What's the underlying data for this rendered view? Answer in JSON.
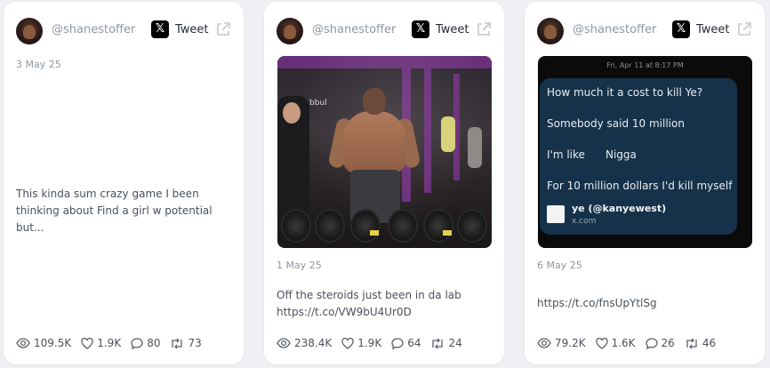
{
  "cards": [
    {
      "handle": "@shanestoffer",
      "tweet_label": "Tweet",
      "date": "3 May 25",
      "text_lines": [
        "This kinda sum crazy game I been",
        "thinking about Find a girl w potential but..."
      ],
      "stats": {
        "views": "109.5K",
        "likes": "1.9K",
        "replies": "80",
        "retweets": "73"
      }
    },
    {
      "handle": "@shanestoffer",
      "tweet_label": "Tweet",
      "date": "1 May 25",
      "text_lines": [
        "Off the steroids just been in da lab",
        "https://t.co/VW9bU4Ur0D"
      ],
      "stats": {
        "views": "238.4K",
        "likes": "1.9K",
        "replies": "64",
        "retweets": "24"
      },
      "photo_watermark": "bbul"
    },
    {
      "handle": "@shanestoffer",
      "tweet_label": "Tweet",
      "date": "6 May 25",
      "text_lines": [
        "https://t.co/fnsUpYtlSg"
      ],
      "stats": {
        "views": "79.2K",
        "likes": "1.6K",
        "replies": "26",
        "retweets": "46"
      },
      "message": {
        "time": "Fri, Apr 11 at 8:17 PM",
        "lines": [
          "How much it a cost to kill Ye?",
          "Somebody said 10 million",
          "I'm like",
          "Nigga",
          "For 10 million dollars I'd kill myself"
        ],
        "link_title": "ye (@kanyewest)",
        "link_url": "x.com"
      }
    }
  ],
  "icons": {
    "platform": "x-logo-icon",
    "open": "external-link-icon",
    "views": "eye-icon",
    "likes": "heart-icon",
    "replies": "comment-icon",
    "retweets": "retweet-icon"
  },
  "colors": {
    "muted": "#8f96a3",
    "text": "#4a515c",
    "bubble": "#16324a",
    "gym_purple": "#6a2f7a"
  }
}
